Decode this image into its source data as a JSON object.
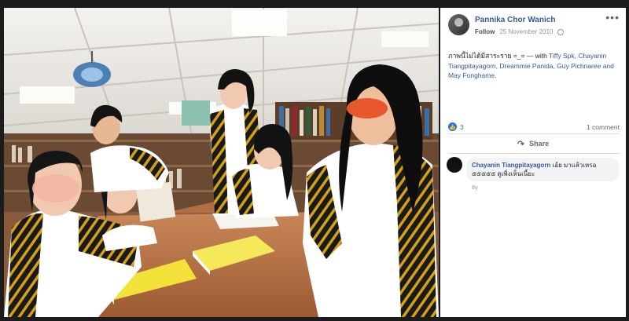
{
  "post": {
    "author": "Pannika Chor Wanich",
    "follow_label": "Follow",
    "date": "25 November 2010",
    "caption_text": "ภาพนี้ไม่ได้มีสาระราย =_= — with ",
    "tagged": "Tiffy Spk, Chayanin Tiangpitayagorn, Dreammie Panida, Guy Pichnaree and May Fonghame.",
    "like_count": "3",
    "comment_count": "1 comment",
    "share_label": "Share",
    "more_icon": "more-options-icon",
    "privacy_icon": "globe-icon"
  },
  "comment": {
    "author": "Chayanin Tiangpitayagorn",
    "text": " เอ้ย มาแล้วเหรอ ๕๕๕๕๕ ดูเพิ่งเห็นเนี้ยะ",
    "time": "8y"
  },
  "colors": {
    "link": "#385898",
    "like": "#1877f2",
    "gown_black": "#1a1a1a",
    "gown_gold": "#d4a017"
  }
}
